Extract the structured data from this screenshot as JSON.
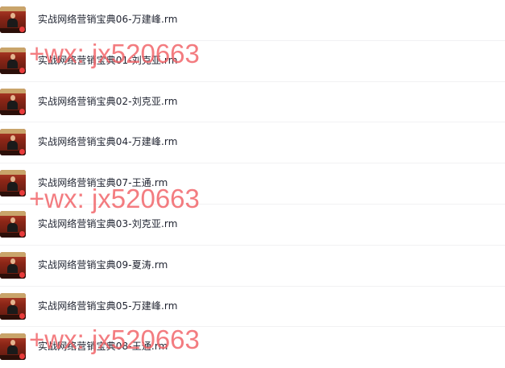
{
  "files": [
    {
      "name": "实战网络营销宝典06-万建峰.rm",
      "icon": "video-thumbnail-icon"
    },
    {
      "name": "实战网络营销宝典01-刘克亚.rm",
      "icon": "video-thumbnail-icon"
    },
    {
      "name": "实战网络营销宝典02-刘克亚.rm",
      "icon": "video-thumbnail-icon"
    },
    {
      "name": "实战网络营销宝典04-万建峰.rm",
      "icon": "video-thumbnail-icon"
    },
    {
      "name": "实战网络营销宝典07-王通.rm",
      "icon": "video-thumbnail-icon"
    },
    {
      "name": "实战网络营销宝典03-刘克亚.rm",
      "icon": "video-thumbnail-icon"
    },
    {
      "name": "实战网络营销宝典09-夏涛.rm",
      "icon": "video-thumbnail-icon"
    },
    {
      "name": "实战网络营销宝典05-万建峰.rm",
      "icon": "video-thumbnail-icon"
    },
    {
      "name": "实战网络营销宝典08-王通.rm",
      "icon": "video-thumbnail-icon"
    }
  ],
  "watermark": {
    "text": "+wx: jx520663",
    "color": "#f05f64"
  }
}
